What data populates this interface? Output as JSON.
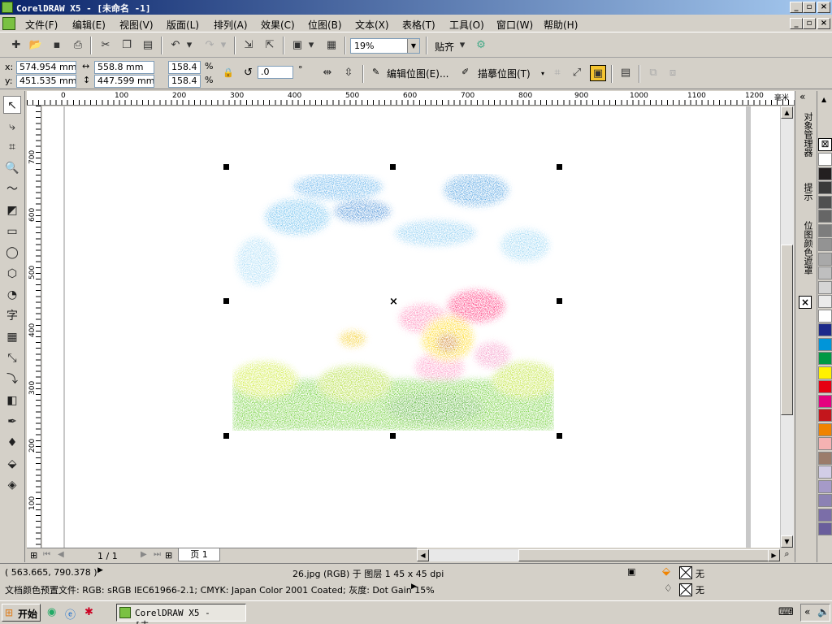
{
  "window": {
    "title": "CorelDRAW X5 - [未命名 -1]",
    "min": "_",
    "max": "▫",
    "close": "×"
  },
  "menu": [
    "文件(F)",
    "编辑(E)",
    "视图(V)",
    "版面(L)",
    "排列(A)",
    "效果(C)",
    "位图(B)",
    "文本(X)",
    "表格(T)",
    "工具(O)",
    "窗口(W)",
    "帮助(H)"
  ],
  "toolbar": {
    "zoom": "19%",
    "snap_label": "贴齐"
  },
  "properties": {
    "x_label": "x:",
    "x_value": "574.954 mm",
    "y_label": "y:",
    "y_value": "451.535 mm",
    "w_value": "558.8 mm",
    "h_value": "447.599 mm",
    "scale_w": "158.4",
    "scale_h": "158.4",
    "pct": "%",
    "rotation": ".0",
    "degree": "°",
    "edit_bitmap": "编辑位图(E)...",
    "trace_bitmap": "描摹位图(T)"
  },
  "ruler": {
    "unit": "毫米",
    "h_ticks": [
      "0",
      "100",
      "200",
      "300",
      "400",
      "500",
      "600",
      "700",
      "800",
      "900",
      "1000",
      "1100",
      "1200"
    ],
    "v_ticks": [
      "700",
      "600",
      "500",
      "400",
      "300",
      "200",
      "100"
    ]
  },
  "pagenav": {
    "counter": "1 / 1",
    "page_tab": "页 1"
  },
  "docker_tabs": [
    "对象管理器",
    "提示",
    "位图颜色遮罩"
  ],
  "palette": [
    "#ffffff",
    "#231f20",
    "#3a3a3a",
    "#505050",
    "#666666",
    "#7d7d7d",
    "#939393",
    "#a9a9a9",
    "#bfbfbf",
    "#d5d5d5",
    "#ebebeb",
    "#ffffff",
    "#1d2a8a",
    "#0095d9",
    "#009944",
    "#fff100",
    "#e60012",
    "#e4007f",
    "#c3161c",
    "#f08300",
    "#f5b2b2",
    "#9b7c6b",
    "#d2cde6",
    "#a59ac8",
    "#8c82b4",
    "#7b6ea8",
    "#6a5e9c"
  ],
  "status": {
    "coords": "( 563.665, 790.378 )",
    "object_info": "26.jpg (RGB) 于 图层 1 45 x 45 dpi",
    "profile": "文档颜色预置文件: RGB: sRGB IEC61966-2.1; CMYK: Japan Color 2001 Coated; 灰度: Dot Gain 15%",
    "fill_none": "无",
    "outline_none": "无"
  },
  "taskbar": {
    "start": "开始",
    "task": "CorelDRAW X5 - [未..."
  }
}
